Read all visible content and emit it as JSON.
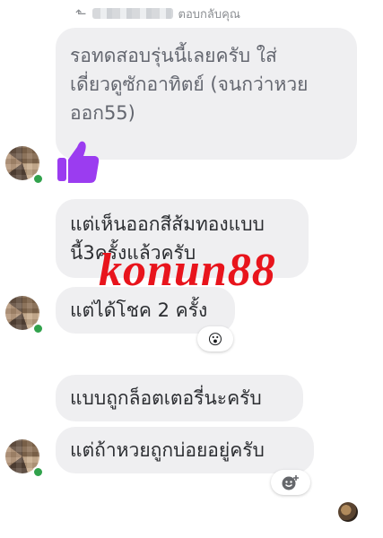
{
  "reply_header": {
    "label": "ตอบกลับคุณ",
    "icon": "reply-arrow-icon"
  },
  "messages": [
    {
      "text": "รอทดสอบรุ่นนี้เลยครับ ใส่\nเดี่ยวดูซักอาทิตย์ (จนกว่าหวย\nออก55)"
    },
    {
      "text": "แต่เห็นออกสีส้มทองแบบ\nนี้3ครั้งแล้วครับ"
    },
    {
      "text": "แต่ได้โชค 2 ครั้ง"
    },
    {
      "text": "แบบถูกล็อตเตอรี่นะครับ"
    },
    {
      "text": "แต่ถ้าหวยถูกบ่อยอยู่ครับ"
    }
  ],
  "reactions": {
    "emoji_1": "😮",
    "add_reaction_icon": "add-reaction-icon"
  },
  "thumbs_up_color": "#9b3cf0",
  "online_color": "#31a24c",
  "watermark": "konun88"
}
